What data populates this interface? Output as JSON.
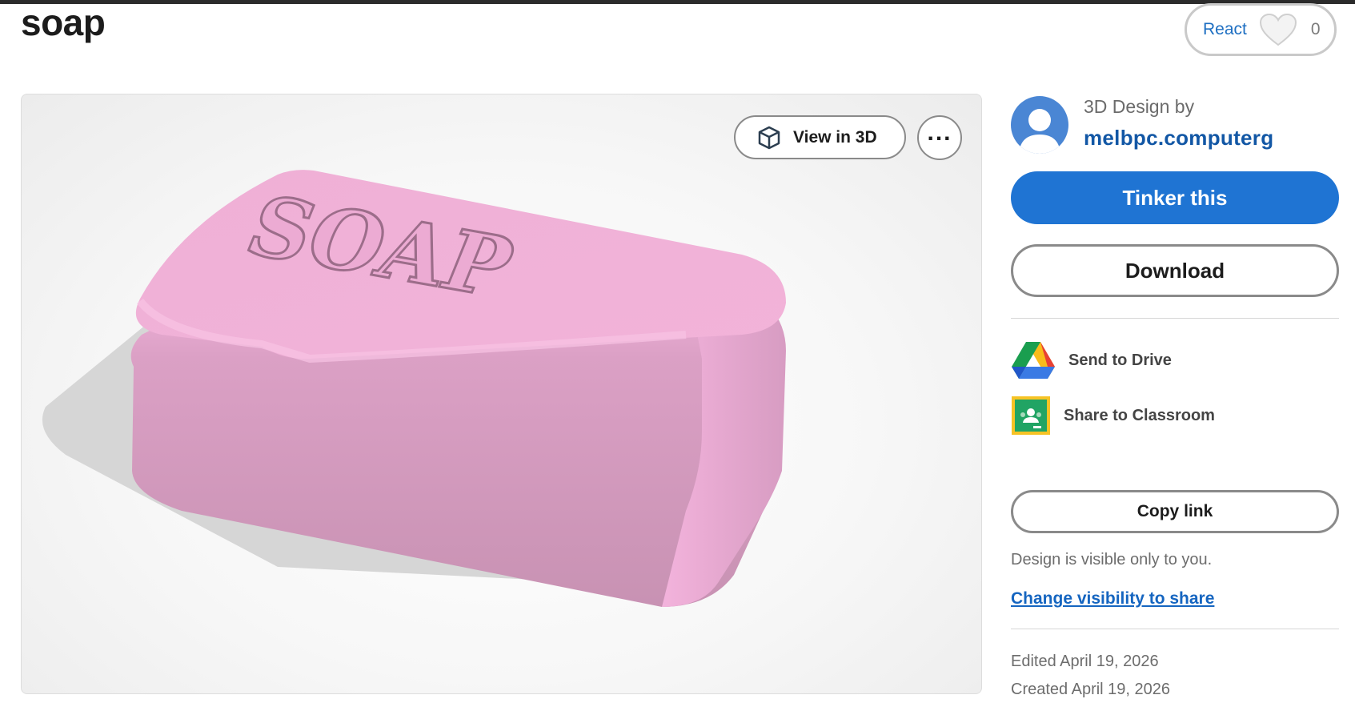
{
  "page": {
    "title": "soap"
  },
  "reactions": {
    "label": "React",
    "count": "0",
    "icon": "heart-icon"
  },
  "viewer": {
    "view_3d_label": "View in 3D",
    "view_3d_icon": "cube-icon",
    "more_icon": "more-options-icon",
    "model_text": "SOAP",
    "model_color": "#f4aed6"
  },
  "designer": {
    "caption": "3D Design by",
    "name": "melbpc.computerg",
    "avatar_color": "#4a86d4"
  },
  "actions": {
    "tinker_label": "Tinker this",
    "download_label": "Download",
    "send_drive_label": "Send to Drive",
    "share_classroom_label": "Share to Classroom",
    "copy_link_label": "Copy link"
  },
  "visibility": {
    "note": "Design is visible only to you.",
    "change_link": "Change visibility to share"
  },
  "meta": {
    "edited": "Edited April 19, 2026",
    "created": "Created April 19, 2026"
  },
  "colors": {
    "accent": "#1f74d3",
    "link": "#1565c0"
  }
}
